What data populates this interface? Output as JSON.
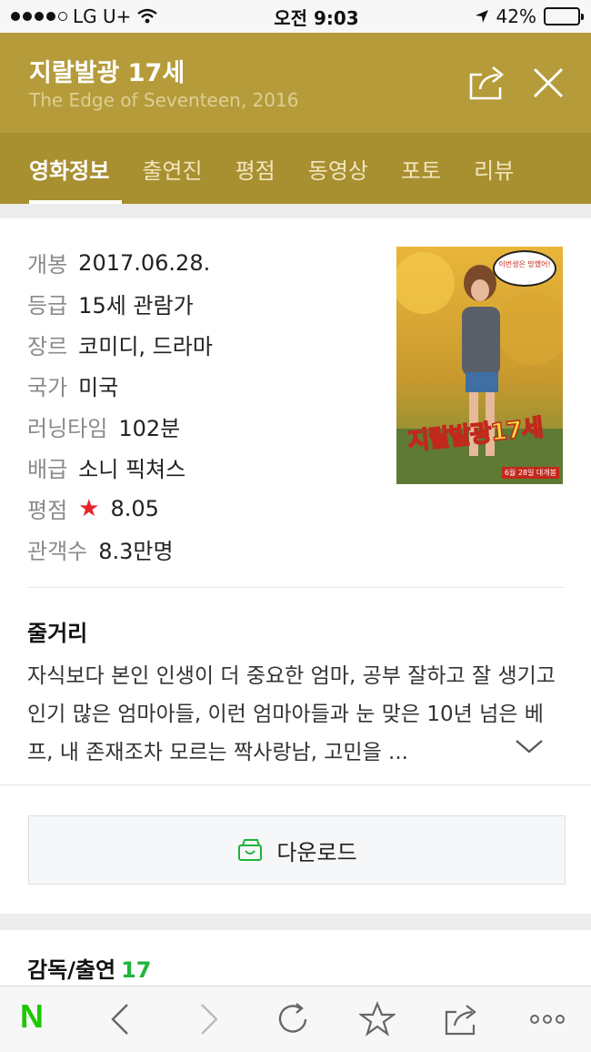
{
  "status_bar": {
    "carrier": "LG U+",
    "time": "오전 9:03",
    "battery": "42%",
    "battery_level": 0.42
  },
  "header": {
    "title": "지랄발광 17세",
    "subtitle": "The Edge of Seventeen, 2016"
  },
  "tabs": [
    {
      "label": "영화정보",
      "active": true
    },
    {
      "label": "출연진"
    },
    {
      "label": "평점"
    },
    {
      "label": "동영상"
    },
    {
      "label": "포토"
    },
    {
      "label": "리뷰"
    }
  ],
  "info": {
    "release": {
      "label": "개봉",
      "value": "2017.06.28."
    },
    "rating_grade": {
      "label": "등급",
      "value": "15세 관람가"
    },
    "genre": {
      "label": "장르",
      "value": "코미디, 드라마"
    },
    "country": {
      "label": "국가",
      "value": "미국"
    },
    "runtime": {
      "label": "러닝타임",
      "value": "102분"
    },
    "distributor": {
      "label": "배급",
      "value": "소니 픽쳐스"
    },
    "score": {
      "label": "평점",
      "value": "8.05"
    },
    "audience": {
      "label": "관객수",
      "value": "8.3만명"
    }
  },
  "poster": {
    "title_text": "지랄발광17세",
    "bubble_text": "이번생은 망했어!",
    "date_text": "6월 28일 대개봉"
  },
  "synopsis": {
    "heading": "줄거리",
    "text": "자식보다 본인 인생이 더 중요한 엄마, 공부 잘하고 잘 생기고 인기 많은 엄마아들, 이런 엄마아들과 눈 맞은 10년 넘은 베프, 내 존재조차 모르는 짝사랑남, 고민을 ..."
  },
  "download": {
    "label": "다운로드"
  },
  "cast": {
    "heading": "감독/출연",
    "count": "17"
  },
  "toolbar": {
    "logo": "N",
    "colors": {
      "brand": "#1ec800",
      "header": "#b59b3a",
      "tabs": "#a88f30",
      "star": "#e8232b",
      "count": "#1eb53a"
    }
  }
}
